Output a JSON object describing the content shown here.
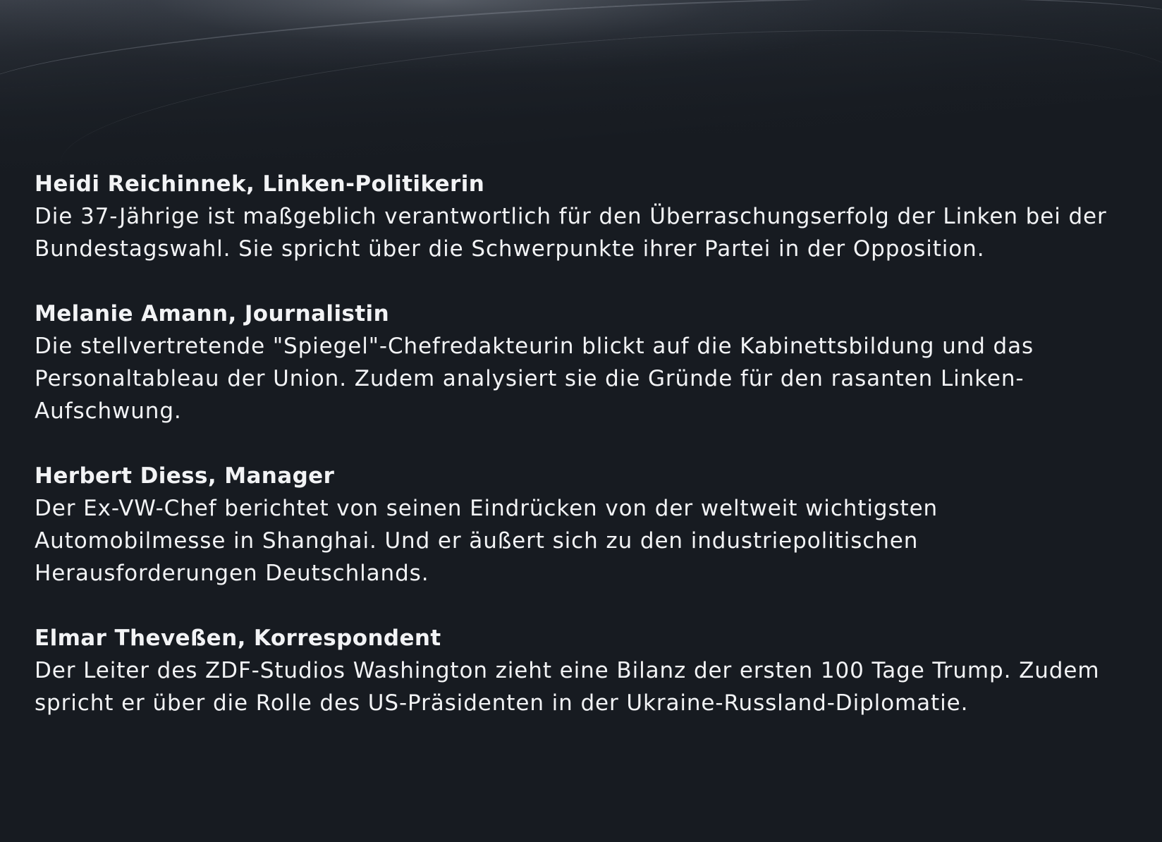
{
  "guests": [
    {
      "name": "Heidi Reichinnek, Linken-Politikerin",
      "description": "Die 37-Jährige ist maßgeblich verantwortlich für den Überraschungserfolg der Linken bei der Bundestagswahl. Sie spricht über die Schwerpunkte ihrer Partei in der Opposition."
    },
    {
      "name": "Melanie Amann, Journalistin",
      "description": "Die stellvertretende \"Spiegel\"-Chefredakteurin blickt auf die Kabinettsbildung und das Personaltableau der Union. Zudem analysiert sie die Gründe für den rasanten Linken-Aufschwung."
    },
    {
      "name": "Herbert Diess, Manager",
      "description": "Der Ex-VW-Chef berichtet von seinen Eindrücken von der weltweit wichtigsten Automobilmesse in Shanghai. Und er äußert sich zu den industriepolitischen Herausforderungen Deutschlands."
    },
    {
      "name": "Elmar Theveßen, Korrespondent",
      "description": "Der Leiter des ZDF-Studios Washington zieht eine Bilanz der ersten 100 Tage Trump. Zudem spricht er über die Rolle des US-Präsidenten in der Ukraine-Russland-Diplomatie."
    }
  ]
}
